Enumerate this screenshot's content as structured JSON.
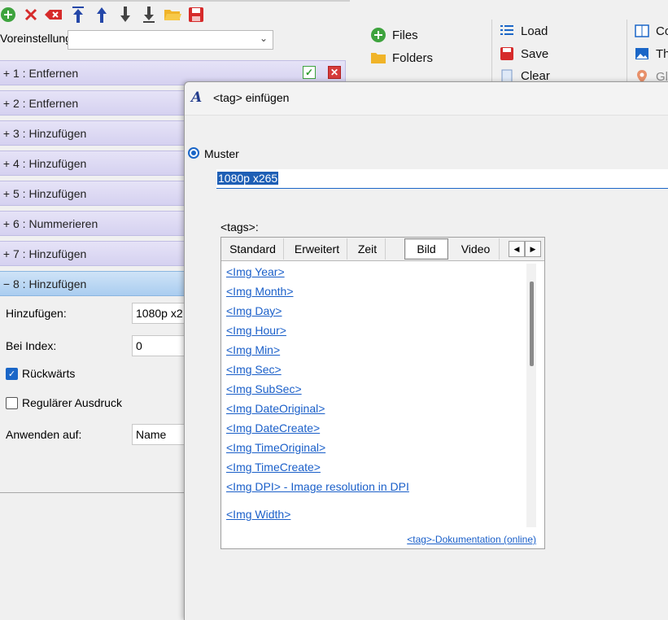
{
  "toolbar": {
    "icons": [
      "add-icon",
      "delete-icon",
      "clear-icon",
      "move-top-icon",
      "move-up-icon",
      "move-down-icon",
      "move-bottom-icon",
      "folder-open-icon",
      "save-icon"
    ]
  },
  "preset": {
    "label": "Voreinstellung",
    "value": ""
  },
  "rules": [
    {
      "toggle": "+",
      "label": "1 : Entfernen"
    },
    {
      "toggle": "+",
      "label": "2 : Entfernen"
    },
    {
      "toggle": "+",
      "label": "3 : Hinzufügen"
    },
    {
      "toggle": "+",
      "label": "4 : Hinzufügen"
    },
    {
      "toggle": "+",
      "label": "5 : Hinzufügen"
    },
    {
      "toggle": "+",
      "label": "6 : Nummerieren"
    },
    {
      "toggle": "+",
      "label": "7 : Hinzufügen"
    },
    {
      "toggle": "−",
      "label": "8 : Hinzufügen"
    }
  ],
  "detail": {
    "add_label": "Hinzufügen:",
    "add_value": "1080p x2",
    "index_label": "Bei Index:",
    "index_value": "0",
    "reverse_label": "Rückwärts",
    "reverse_checked": true,
    "regex_label": "Regulärer Ausdruck",
    "regex_checked": false,
    "apply_label": "Anwenden auf:",
    "apply_value": "Name"
  },
  "sidebar_buttons": {
    "files": "Files",
    "folders": "Folders",
    "load": "Load",
    "save": "Save",
    "clear": "Clear",
    "col3_a": "Co",
    "col3_b": "Th",
    "col3_c": "Gl"
  },
  "dialog": {
    "title": "<tag> einfügen",
    "muster_label": "Muster",
    "pattern_value": "1080p x265",
    "tags_label": "<tags>:",
    "tabs": [
      "Standard",
      "Erweitert",
      "Zeit",
      "Bild",
      "Video"
    ],
    "selected_tab": "Bild",
    "tags": [
      "<Img Year>",
      "<Img Month>",
      "<Img Day>",
      "<Img Hour>",
      "<Img Min>",
      "<Img Sec>",
      "<Img SubSec>",
      "<Img DateOriginal>",
      "<Img DateCreate>",
      "<Img TimeOriginal>",
      "<Img TimeCreate>",
      "<Img DPI> - Image resolution in DPI",
      "<Img Width>"
    ],
    "doc_link": "<tag>-Dokumentation (online)"
  },
  "colors": {
    "accent": "#1a66c7",
    "rule_bg": "#d9d6f2",
    "active_rule_bg": "#b7d6f4",
    "link": "#1a5fc9"
  }
}
